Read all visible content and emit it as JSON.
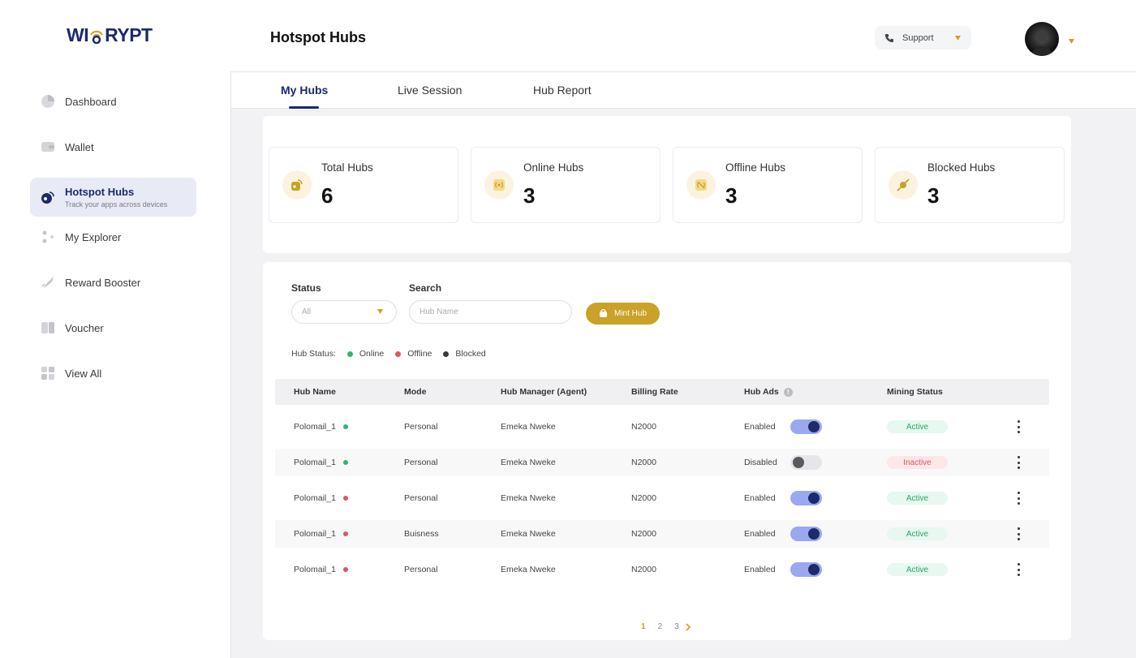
{
  "brand": {
    "logo_left": "WI",
    "logo_right": "RYPT"
  },
  "sidebar": {
    "items": [
      {
        "label": "Dashboard",
        "icon": "pie-chart-icon"
      },
      {
        "label": "Wallet",
        "icon": "wallet-icon"
      },
      {
        "label": "Hotspot Hubs",
        "sub": "Track your apps across devices",
        "icon": "hotspot-icon",
        "active": true
      },
      {
        "label": "My Explorer",
        "icon": "explorer-icon"
      },
      {
        "label": "Reward Booster",
        "icon": "rocket-icon"
      },
      {
        "label": "Voucher",
        "icon": "voucher-icon"
      },
      {
        "label": "View All",
        "icon": "grid-icon"
      }
    ]
  },
  "header": {
    "title": "Hotspot Hubs",
    "support_label": "Support"
  },
  "tabs": [
    {
      "label": "My Hubs",
      "active": true
    },
    {
      "label": "Live Session"
    },
    {
      "label": "Hub Report"
    }
  ],
  "stats": [
    {
      "label": "Total Hubs",
      "value": "6",
      "icon": "hub-icon"
    },
    {
      "label": "Online Hubs",
      "value": "3",
      "icon": "online-signal-icon"
    },
    {
      "label": "Offline Hubs",
      "value": "3",
      "icon": "offline-signal-icon"
    },
    {
      "label": "Blocked Hubs",
      "value": "3",
      "icon": "blocked-icon"
    }
  ],
  "filters": {
    "status_label": "Status",
    "status_value": "All",
    "search_label": "Search",
    "search_placeholder": "Hub Name",
    "mint_label": "Mint Hub"
  },
  "legend": {
    "title": "Hub Status:",
    "items": [
      {
        "label": "Online",
        "color": "#2bb673"
      },
      {
        "label": "Offline",
        "color": "#e0555f"
      },
      {
        "label": "Blocked",
        "color": "#3a3a3e"
      }
    ]
  },
  "table": {
    "headers": [
      "Hub Name",
      "Mode",
      "Hub Manager (Agent)",
      "Billing Rate",
      "Hub Ads",
      "Mining Status"
    ],
    "rows": [
      {
        "name": "Polomail_1",
        "status_color": "#2bb673",
        "mode": "Personal",
        "manager": "Emeka Nweke",
        "rate": "N2000",
        "ads": "Enabled",
        "ads_on": true,
        "mining": "Active"
      },
      {
        "name": "Polomail_1",
        "status_color": "#2bb673",
        "mode": "Personal",
        "manager": "Emeka Nweke",
        "rate": "N2000",
        "ads": "Disabled",
        "ads_on": false,
        "mining": "Inactive"
      },
      {
        "name": "Polomail_1",
        "status_color": "#e0555f",
        "mode": "Personal",
        "manager": "Emeka Nweke",
        "rate": "N2000",
        "ads": "Enabled",
        "ads_on": true,
        "mining": "Active"
      },
      {
        "name": "Polomail_1",
        "status_color": "#e0555f",
        "mode": "Buisness",
        "manager": "Emeka Nweke",
        "rate": "N2000",
        "ads": "Enabled",
        "ads_on": true,
        "mining": "Active"
      },
      {
        "name": "Polomail_1",
        "status_color": "#e0555f",
        "mode": "Personal",
        "manager": "Emeka Nweke",
        "rate": "N2000",
        "ads": "Enabled",
        "ads_on": true,
        "mining": "Active"
      }
    ]
  },
  "pagination": {
    "pages": [
      "1",
      "2",
      "3"
    ],
    "current": "1"
  },
  "colors": {
    "primary": "#1d2a6b",
    "accent": "#c9a227"
  }
}
